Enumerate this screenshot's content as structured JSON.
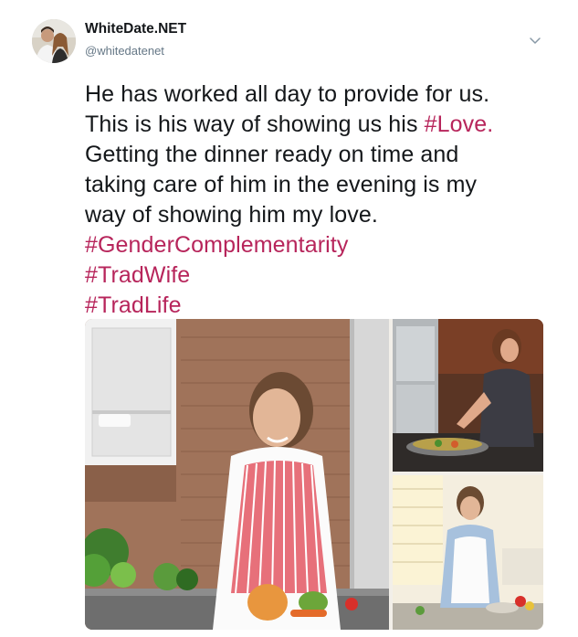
{
  "tweet": {
    "display_name": "WhiteDate.NET",
    "handle": "@whitedatenet",
    "text_lines": [
      "He has worked all day to provide for us.",
      "This is his way of showing us his ",
      "Getting the dinner ready on time and",
      "taking care of him in the evening is my",
      "way of showing him my love."
    ],
    "inline_hashtag": "#Love.",
    "hashtags": [
      "#GenderComplementarity",
      "#TradWife",
      "#TradLife"
    ],
    "images": [
      "woman-cutting-vegetables-photo",
      "woman-cooking-at-stove-photo",
      "woman-in-apron-kitchen-photo"
    ]
  },
  "icons": {
    "more": "chevron-down-icon"
  },
  "colors": {
    "hashtag": "#b7255b",
    "handle": "#657786",
    "text": "#14171a"
  }
}
